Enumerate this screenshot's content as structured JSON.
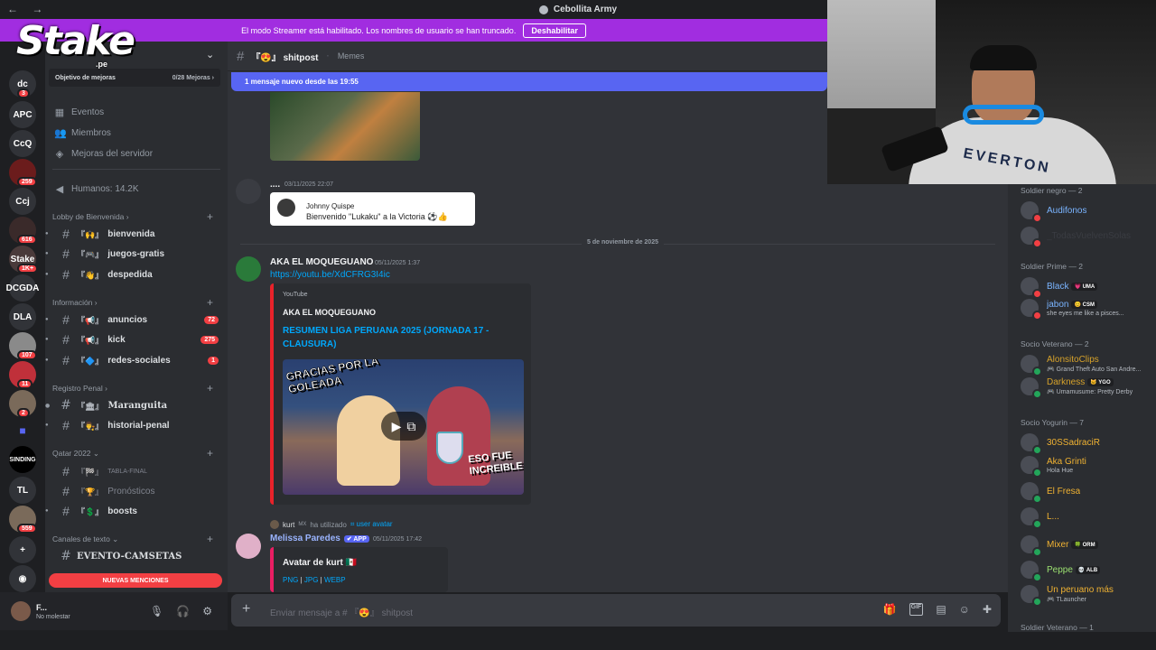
{
  "window": {
    "title": "Cebollita Army",
    "nav": "← →"
  },
  "banner": {
    "text": "El modo Streamer está habilitado. Los nombres de usuario se han truncado.",
    "button": "Deshabilitar"
  },
  "logo": {
    "word": "Stake",
    "sub": ".pe"
  },
  "rail": [
    {
      "label": "dc",
      "badge": "3",
      "kind": "text"
    },
    {
      "label": "APC",
      "badge": "",
      "kind": "text"
    },
    {
      "label": "CcQ",
      "badge": "",
      "kind": "text"
    },
    {
      "label": "",
      "badge": "259",
      "kind": "img2"
    },
    {
      "label": "Ccj",
      "badge": "",
      "kind": "text"
    },
    {
      "label": "",
      "badge": "616",
      "kind": "img1"
    },
    {
      "label": "Stake",
      "badge": "1K+",
      "kind": "img3"
    },
    {
      "label": "DCGDA",
      "badge": "",
      "kind": "text"
    },
    {
      "label": "DLA",
      "badge": "",
      "kind": "text"
    },
    {
      "label": "",
      "badge": "107",
      "kind": "img4"
    },
    {
      "label": "",
      "badge": "11",
      "kind": "img5"
    },
    {
      "label": "",
      "badge": "2",
      "kind": "img6"
    },
    {
      "label": "■",
      "badge": "",
      "kind": "purple"
    },
    {
      "label": "SINDING",
      "badge": "",
      "kind": "dark"
    },
    {
      "label": "TL",
      "badge": "",
      "kind": "text"
    },
    {
      "label": "",
      "badge": "559",
      "kind": "img6"
    },
    {
      "label": "+",
      "badge": "",
      "kind": "text"
    },
    {
      "label": "◉",
      "badge": "",
      "kind": "text"
    }
  ],
  "sidebar": {
    "goal": {
      "label": "Objetivo de mejoras",
      "count": "0/28 Mejoras ›"
    },
    "nav": [
      {
        "icon": "▦",
        "label": "Eventos"
      },
      {
        "icon": "👥",
        "label": "Miembros"
      },
      {
        "icon": "◈",
        "label": "Mejoras del servidor"
      }
    ],
    "humans": {
      "icon": "◀",
      "label": "Humanos: 14.2K"
    },
    "categories": {
      "lobby": "Lobby de Bienvenida ›",
      "info": "Información ›",
      "registro": "Registro Penal ›",
      "qatar": "Qatar 2022 ⌄",
      "texto": "Canales de texto ⌄"
    },
    "channels": {
      "bienvenida": {
        "emoji": "『🙌』",
        "name": "bienvenida",
        "count": ""
      },
      "juegos": {
        "emoji": "『🎮』",
        "name": "juegos-gratis",
        "count": ""
      },
      "despedida": {
        "emoji": "『👋』",
        "name": "despedida",
        "count": ""
      },
      "anuncios": {
        "emoji": "『📢』",
        "name": "anuncios",
        "count": "72"
      },
      "kick": {
        "emoji": "『📢』",
        "name": "kick",
        "count": "275"
      },
      "redes": {
        "emoji": "『🔷』",
        "name": "redes-sociales",
        "count": "1"
      },
      "maranguita": {
        "emoji": "『🏛』",
        "name": "Maranguita",
        "count": ""
      },
      "historial": {
        "emoji": "『👨‍⚖️』",
        "name": "historial-penal",
        "count": ""
      },
      "tabla": {
        "emoji": "『🏁』",
        "name": "TABLA-FINAL",
        "count": ""
      },
      "pronosticos": {
        "emoji": "『🏆』",
        "name": "Pronósticos",
        "count": ""
      },
      "boosts": {
        "emoji": "『💲』",
        "name": "boosts",
        "count": ""
      },
      "evento": {
        "emoji": "",
        "name": "EVENTO-CAMSETAS",
        "count": ""
      }
    },
    "new_mentions": "NUEVAS MENCIONES"
  },
  "user": {
    "name": "F...",
    "status": "No molestar",
    "mic": "🎙",
    "headset": "🎧",
    "settings": "⚙"
  },
  "chat": {
    "channel": "『😍』 shitpost",
    "topic": "Memes",
    "new_since": "1 mensaje nuevo desde las 19:55",
    "msg1": {
      "user": "....",
      "time": "03/11/2025 22:07",
      "card_name": "Johnny Quispe",
      "card_text": "Bienvenido \"Lukaku\" a la Victoria ⚽👍"
    },
    "date_sep": "5 de noviembre de 2025",
    "msg2": {
      "user": "AKA EL MOQUEGUANO",
      "time": "05/11/2025 1:37",
      "link": "https://youtu.be/XdCFRG3I4ic",
      "provider": "YouTube",
      "author": "AKA EL MOQUEGUANO",
      "title": "RESUMEN LIGA PERUANA 2025 (JORNADA 17 - CLAUSURA)",
      "thumb_text1": "GRACIAS POR LA GOLEADA",
      "thumb_text2": "ESO FUE INCREIBLE"
    },
    "sys": {
      "user": "kurt",
      "tag": "MX",
      "text": "ha utilizado",
      "cmd": "⌗ user avatar"
    },
    "msg3": {
      "user": "Melissa Paredes",
      "app": "✔ APP",
      "time": "05/11/2025 17:42",
      "embed_title": "Avatar de kurt 🇲🇽",
      "links": [
        "PNG",
        "JPG",
        "WEBP"
      ],
      "sep": " | "
    },
    "composer": "Enviar mensaje a # 『😍』 shitpost",
    "composer_tools": [
      "🎁",
      "GIF",
      "▤",
      "☺",
      "✚"
    ]
  },
  "members": {
    "groups": [
      {
        "title": "Soldier negro — 2"
      },
      {
        "title": "Soldier Prime — 2"
      },
      {
        "title": "Socio Veterano — 2"
      },
      {
        "title": "Socio Yogurin — 7"
      },
      {
        "title": "Soldier Veterano — 1"
      }
    ],
    "list": [
      {
        "name": "Audifonos",
        "color": "#7ab4ff",
        "status": "",
        "tag": "",
        "st": "#f23f43"
      },
      {
        "name": "_TodasVuelvenSolas",
        "color": "#3a3c42",
        "status": "",
        "tag": "",
        "st": "#f23f43"
      },
      {
        "name": "Black",
        "color": "#7ab4ff",
        "status": "",
        "tag": "💗 UMA",
        "st": "#f23f43"
      },
      {
        "name": "jabon",
        "color": "#7ab4ff",
        "status": "she eyes me like a pisces...",
        "tag": "😊 CSM",
        "st": "#f23f43"
      },
      {
        "name": "AlonsitoClips",
        "color": "#d7a22a",
        "status": "🎮 Grand Theft Auto San Andre...",
        "tag": "",
        "st": "#23a55a"
      },
      {
        "name": "Darkness",
        "color": "#d7a22a",
        "status": "🎮 Umamusume: Pretty Derby",
        "tag": "🐱 YGO",
        "st": "#23a55a"
      },
      {
        "name": "30SSadraciR",
        "color": "#f0b232",
        "status": "",
        "tag": "",
        "st": "#23a55a"
      },
      {
        "name": "Aka Grinti",
        "color": "#f0b232",
        "status": "Hola Hue",
        "tag": "",
        "st": "#23a55a"
      },
      {
        "name": "El Fresa",
        "color": "#f0b232",
        "status": "",
        "tag": "",
        "st": "#23a55a"
      },
      {
        "name": "L...",
        "color": "#f0b232",
        "status": "",
        "tag": "",
        "st": "#23a55a"
      },
      {
        "name": "Mixer",
        "color": "#f0b232",
        "status": "",
        "tag": "🍀 ORM",
        "st": "#23a55a"
      },
      {
        "name": "Peppe",
        "color": "#9be070",
        "status": "",
        "tag": "💀 ALB",
        "st": "#23a55a"
      },
      {
        "name": "Un peruano más",
        "color": "#f0b232",
        "status": "🎮 TLauncher",
        "tag": "",
        "st": "#23a55a"
      }
    ]
  },
  "webcam": {
    "shirt_text": "EVERTON"
  }
}
